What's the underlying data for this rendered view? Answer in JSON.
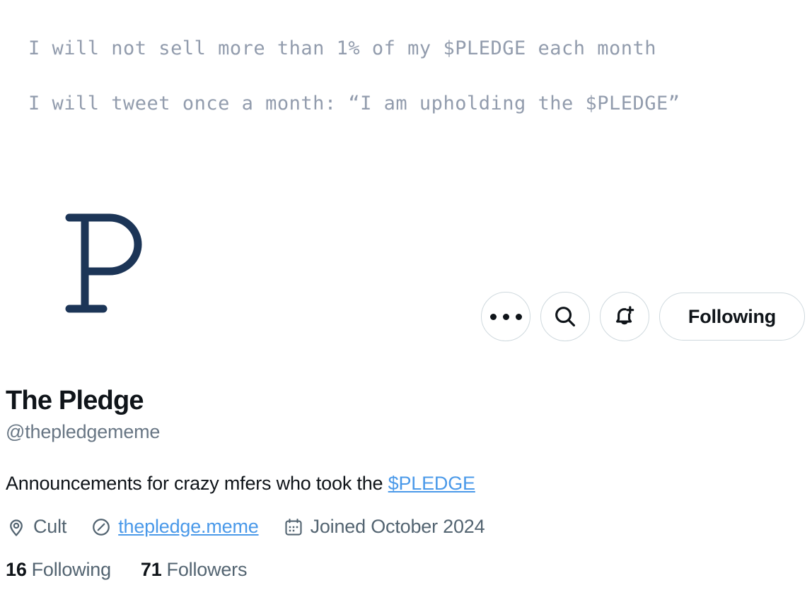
{
  "banner": {
    "line1": "I will not sell more than 1% of my $PLEDGE each month",
    "line2": "I will tweet once a month: “I am upholding the $PLEDGE”",
    "text_color": "#929cad",
    "background": "#ffffff"
  },
  "avatar": {
    "letter": "P",
    "color": "#1c3557",
    "shape": "circle"
  },
  "actions": {
    "more_label": "More",
    "search_label": "Search",
    "notify_label": "Notify",
    "follow_label": "Following"
  },
  "profile": {
    "display_name": "The Pledge",
    "handle": "@thepledgememe",
    "bio_text": "Announcements for crazy mfers who took the ",
    "bio_cashtag": "$PLEDGE",
    "location": "Cult",
    "website": "thepledge.meme",
    "joined": "Joined October 2024",
    "link_color": "#4a99e9"
  },
  "stats": {
    "following_count": "16",
    "following_label": "Following",
    "followers_count": "71",
    "followers_label": "Followers"
  }
}
